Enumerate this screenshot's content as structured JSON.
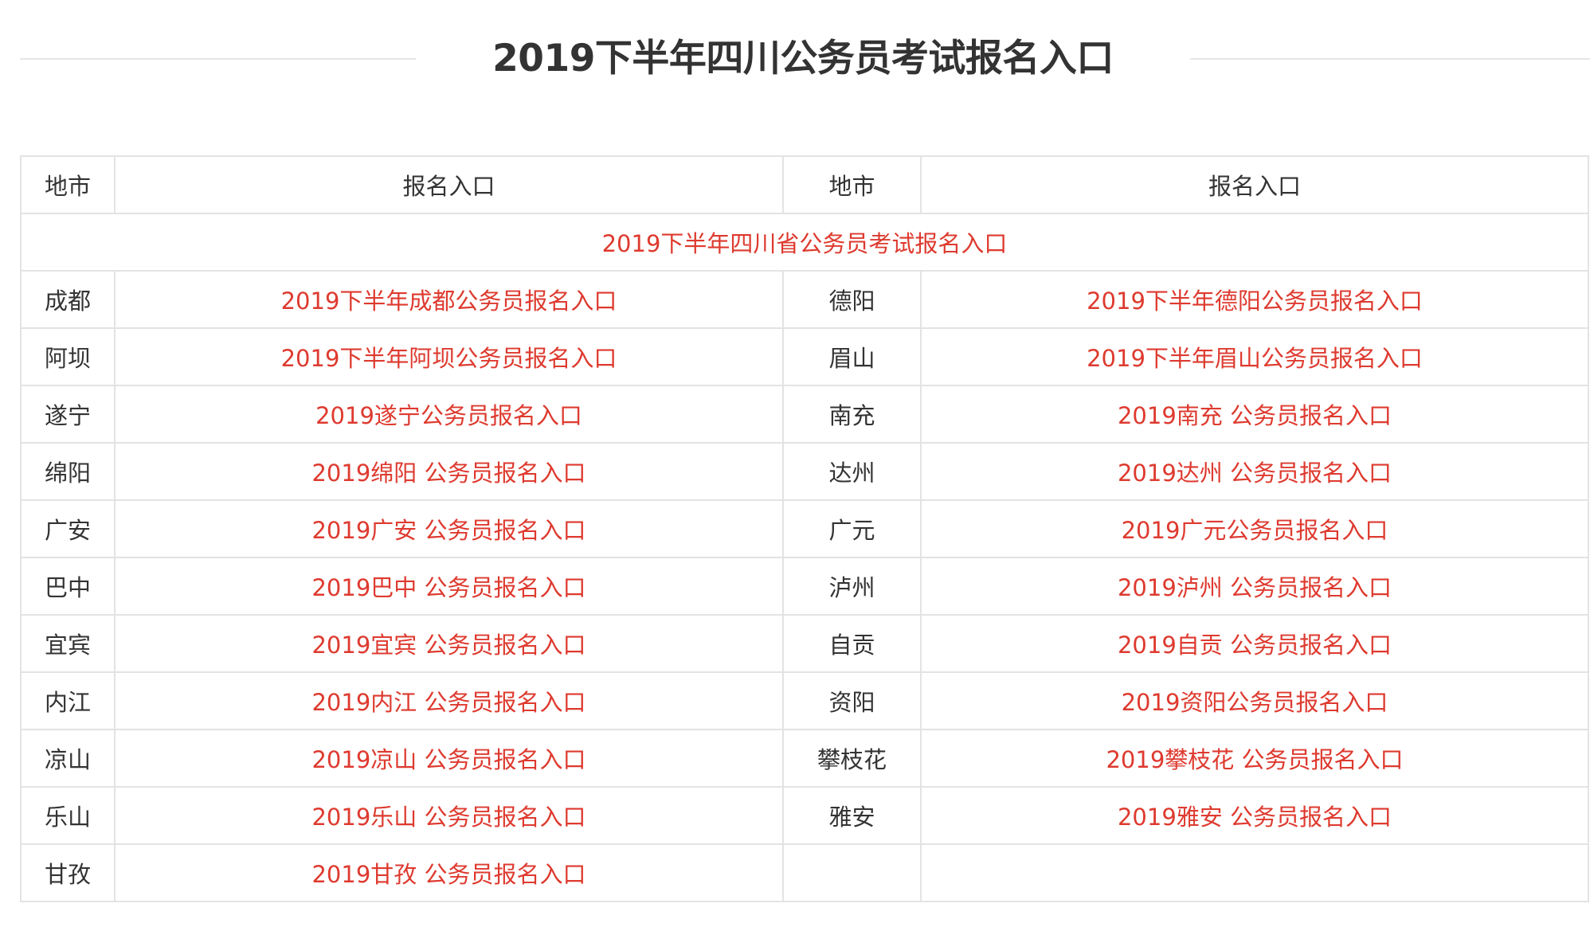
{
  "title": "2019下半年四川公务员考试报名入口",
  "colors": {
    "link": "#de3a2f",
    "text": "#333333",
    "border": "#e3e3e3"
  },
  "table": {
    "headers": [
      "地市",
      "报名入口",
      "地市",
      "报名入口"
    ],
    "province_link": "2019下半年四川省公务员考试报名入口",
    "rows": [
      {
        "city1": "成都",
        "link1": "2019下半年成都公务员报名入口",
        "city2": "德阳",
        "link2": "2019下半年德阳公务员报名入口"
      },
      {
        "city1": "阿坝",
        "link1": "2019下半年阿坝公务员报名入口",
        "city2": "眉山",
        "link2": "2019下半年眉山公务员报名入口"
      },
      {
        "city1": "遂宁",
        "link1": "2019遂宁公务员报名入口",
        "city2": "南充",
        "link2": "2019南充 公务员报名入口"
      },
      {
        "city1": "绵阳",
        "link1": "2019绵阳 公务员报名入口",
        "city2": "达州",
        "link2": "2019达州 公务员报名入口"
      },
      {
        "city1": "广安",
        "link1": "2019广安 公务员报名入口",
        "city2": "广元",
        "link2": "2019广元公务员报名入口"
      },
      {
        "city1": "巴中",
        "link1": "2019巴中 公务员报名入口",
        "city2": "泸州",
        "link2": "2019泸州 公务员报名入口"
      },
      {
        "city1": "宜宾",
        "link1": "2019宜宾 公务员报名入口",
        "city2": "自贡",
        "link2": "2019自贡 公务员报名入口"
      },
      {
        "city1": "内江",
        "link1": "2019内江 公务员报名入口",
        "city2": "资阳",
        "link2": "2019资阳公务员报名入口"
      },
      {
        "city1": "凉山",
        "link1": "2019凉山 公务员报名入口",
        "city2": "攀枝花",
        "link2": "2019攀枝花 公务员报名入口"
      },
      {
        "city1": "乐山",
        "link1": "2019乐山 公务员报名入口",
        "city2": "雅安",
        "link2": "2019雅安 公务员报名入口"
      },
      {
        "city1": "甘孜",
        "link1": "2019甘孜 公务员报名入口",
        "city2": "",
        "link2": ""
      }
    ]
  }
}
